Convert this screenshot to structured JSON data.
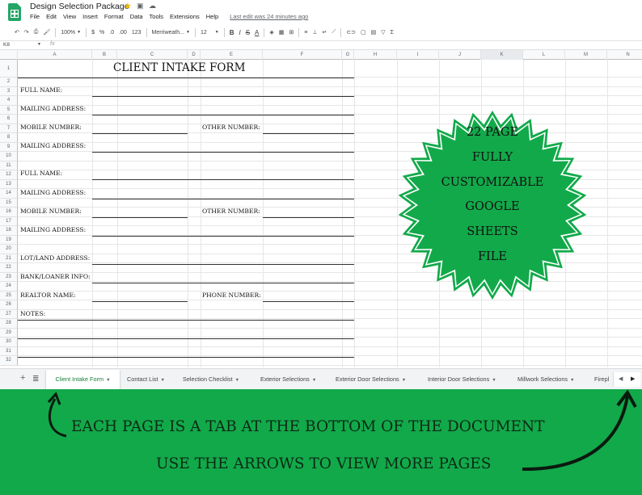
{
  "window": {
    "doc_title": "Design Selection Package",
    "last_edit": "Last edit was 24 minutes ago"
  },
  "menu": [
    "File",
    "Edit",
    "View",
    "Insert",
    "Format",
    "Data",
    "Tools",
    "Extensions",
    "Help"
  ],
  "toolbar": {
    "zoom": "100%",
    "currency": "$",
    "percent": "%",
    "dec_less": ".0",
    "dec_more": ".00",
    "more_formats": "123",
    "font": "Merriweath...",
    "font_size": "12",
    "bold": "B",
    "italic": "I",
    "strike": "S",
    "text_color": "A"
  },
  "formula_bar": {
    "name_box": "K8",
    "fx": "fx"
  },
  "columns": [
    "A",
    "B",
    "C",
    "D",
    "E",
    "F",
    "G",
    "H",
    "I",
    "J",
    "K",
    "L",
    "M",
    "N"
  ],
  "rows": [
    "1",
    "2",
    "3",
    "4",
    "5",
    "6",
    "7",
    "8",
    "9",
    "10",
    "11",
    "12",
    "13",
    "14",
    "15",
    "16",
    "17",
    "18",
    "19",
    "20",
    "21",
    "22",
    "23",
    "24",
    "25",
    "26",
    "27",
    "28",
    "29",
    "30",
    "31",
    "32"
  ],
  "form": {
    "title": "CLIENT INTAKE FORM",
    "labels": {
      "full_name_1": "FULL NAME:",
      "mailing_1": "MAILING ADDRESS:",
      "mobile_1": "MOBILE NUMBER:",
      "other_1": "OTHER NUMBER:",
      "mailing_1b": "MAILING ADDRESS:",
      "full_name_2": "FULL NAME:",
      "mailing_2": "MAILING ADDRESS:",
      "mobile_2": "MOBILE NUMBER:",
      "other_2": "OTHER NUMBER:",
      "mailing_2b": "MAILING ADDRESS:",
      "lot": "LOT/LAND ADDRESS:",
      "bank": "BANK/LOANER INFO:",
      "realtor": "REALTOR NAME:",
      "phone": "PHONE NUMBER:",
      "notes": "NOTES:"
    }
  },
  "badge": {
    "lines": [
      "22 PAGE",
      "FULLY",
      "CUSTOMIZABLE",
      "GOOGLE",
      "SHEETS",
      "FILE"
    ],
    "color": "#12a94a"
  },
  "tabs": [
    "Client Intake Form",
    "Contact List",
    "Selection Checklist",
    "Exterior Selections",
    "Exterior Door Selections",
    "Interior Door Selections",
    "Millwork Selections",
    "Firepl"
  ],
  "banner": {
    "line1": "EACH PAGE IS A TAB AT THE BOTTOM OF THE DOCUMENT",
    "line2": "USE THE ARROWS TO VIEW MORE PAGES",
    "color": "#12a94a"
  }
}
